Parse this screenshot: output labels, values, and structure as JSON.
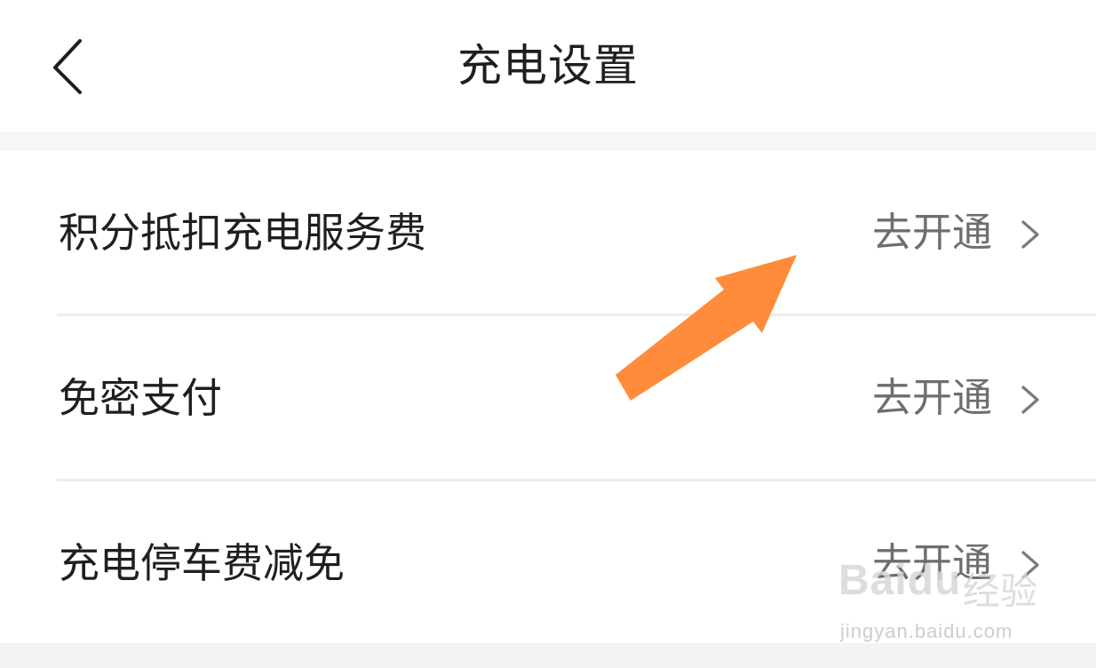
{
  "header": {
    "title": "充电设置",
    "back_icon": "chevron-left-icon"
  },
  "settings": [
    {
      "label": "积分抵扣充电服务费",
      "action": "去开通",
      "icon": "chevron-right-icon"
    },
    {
      "label": "免密支付",
      "action": "去开通",
      "icon": "chevron-right-icon"
    },
    {
      "label": "充电停车费减免",
      "action": "去开通",
      "icon": "chevron-right-icon"
    }
  ],
  "annotation": {
    "icon": "arrow-icon",
    "color": "#ff8c3a"
  },
  "watermark": {
    "logo": "Baidu",
    "brand": "经验",
    "url": "jingyan.baidu.com"
  },
  "colors": {
    "background": "#f6f6f6",
    "card": "#ffffff",
    "text": "#1f1f1f",
    "secondary": "#6e6e6e"
  }
}
